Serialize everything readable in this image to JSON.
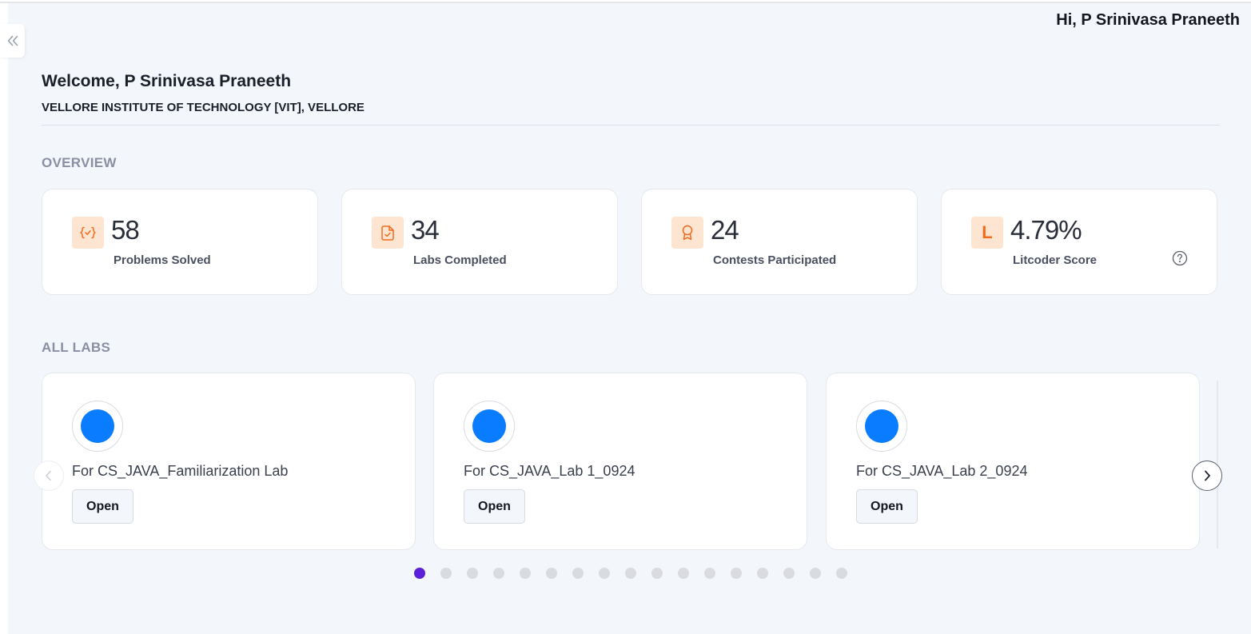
{
  "header": {
    "greeting": "Hi, P Srinivasa Praneeth"
  },
  "sidebar": {
    "toggle_icon": "double-chevron-left-icon"
  },
  "welcome": {
    "title": "Welcome, P Srinivasa Praneeth",
    "institute": "VELLORE INSTITUTE OF TECHNOLOGY [VIT], VELLORE"
  },
  "overview": {
    "label": "OVERVIEW",
    "stats": [
      {
        "value": "58",
        "label": "Problems Solved",
        "icon": "code-braces-check-icon"
      },
      {
        "value": "34",
        "label": "Labs Completed",
        "icon": "file-check-icon"
      },
      {
        "value": "24",
        "label": "Contests Participated",
        "icon": "award-ribbon-icon"
      },
      {
        "value": "4.79%",
        "label": "Litcoder Score",
        "icon": "litcoder-l-icon",
        "icon_text": "L"
      }
    ],
    "accent_color": "#f26b1d",
    "icon_bg_color": "#fde5d2"
  },
  "labs": {
    "label": "ALL LABS",
    "items": [
      {
        "title": "For CS_JAVA_Familiarization Lab",
        "button": "Open"
      },
      {
        "title": "For CS_JAVA_Lab 1_0924",
        "button": "Open"
      },
      {
        "title": "For CS_JAVA_Lab 2_0924",
        "button": "Open"
      }
    ],
    "avatar_color": "#0a7cff",
    "pagination": {
      "total": 17,
      "active": 1,
      "active_color": "#5b21d9"
    }
  }
}
